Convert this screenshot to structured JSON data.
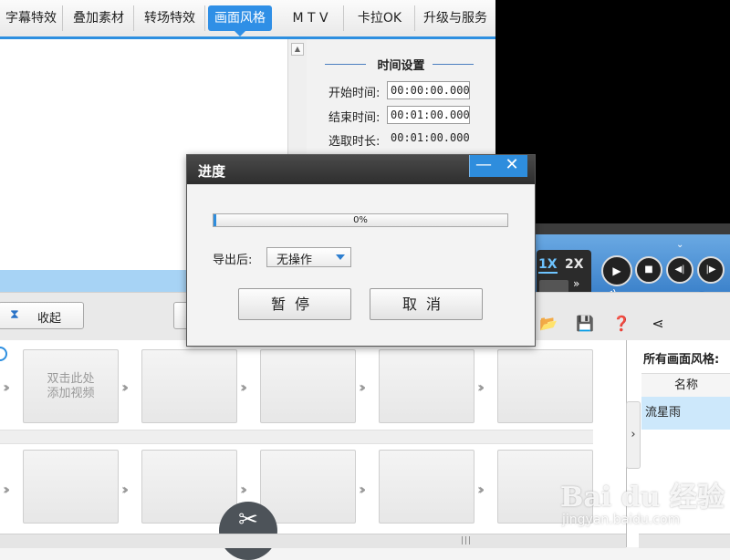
{
  "tabs": [
    {
      "label": "字幕特效",
      "active": false
    },
    {
      "label": "叠加素材",
      "active": false
    },
    {
      "label": "转场特效",
      "active": false
    },
    {
      "label": "画面风格",
      "active": true
    },
    {
      "label": "M T V",
      "active": false
    },
    {
      "label": "卡拉OK",
      "active": false
    },
    {
      "label": "升级与服务",
      "active": false
    }
  ],
  "time_settings": {
    "title": "时间设置",
    "start_label": "开始时间:",
    "start_value": "00:00:00.000",
    "end_label": "结束时间:",
    "end_value": "00:01:00.000",
    "duration_label": "选取时长:",
    "duration_value": "00:01:00.000"
  },
  "player": {
    "speed_1x": "1X",
    "speed_2x": "2X",
    "volume_level": 1.0
  },
  "toolbar": {
    "collapse_label": "收起"
  },
  "timeline": {
    "add_video_hint": "双击此处\n添加视频"
  },
  "style_panel": {
    "header": "所有画面风格:",
    "column": "名称",
    "items": [
      "流星雨"
    ]
  },
  "dialog": {
    "title": "进度",
    "progress_percent": "0%",
    "progress_value": 0.01,
    "after_export_label": "导出后:",
    "after_export_value": "无操作",
    "pause_label": "暂停",
    "cancel_label": "取消"
  },
  "watermark": {
    "brand": "Bai du 经验",
    "url": "jingyan.baidu.com"
  },
  "colors": {
    "accent": "#2f8fe6",
    "dialog_titlebar": "#333333",
    "selected_row": "#cde8fb"
  }
}
